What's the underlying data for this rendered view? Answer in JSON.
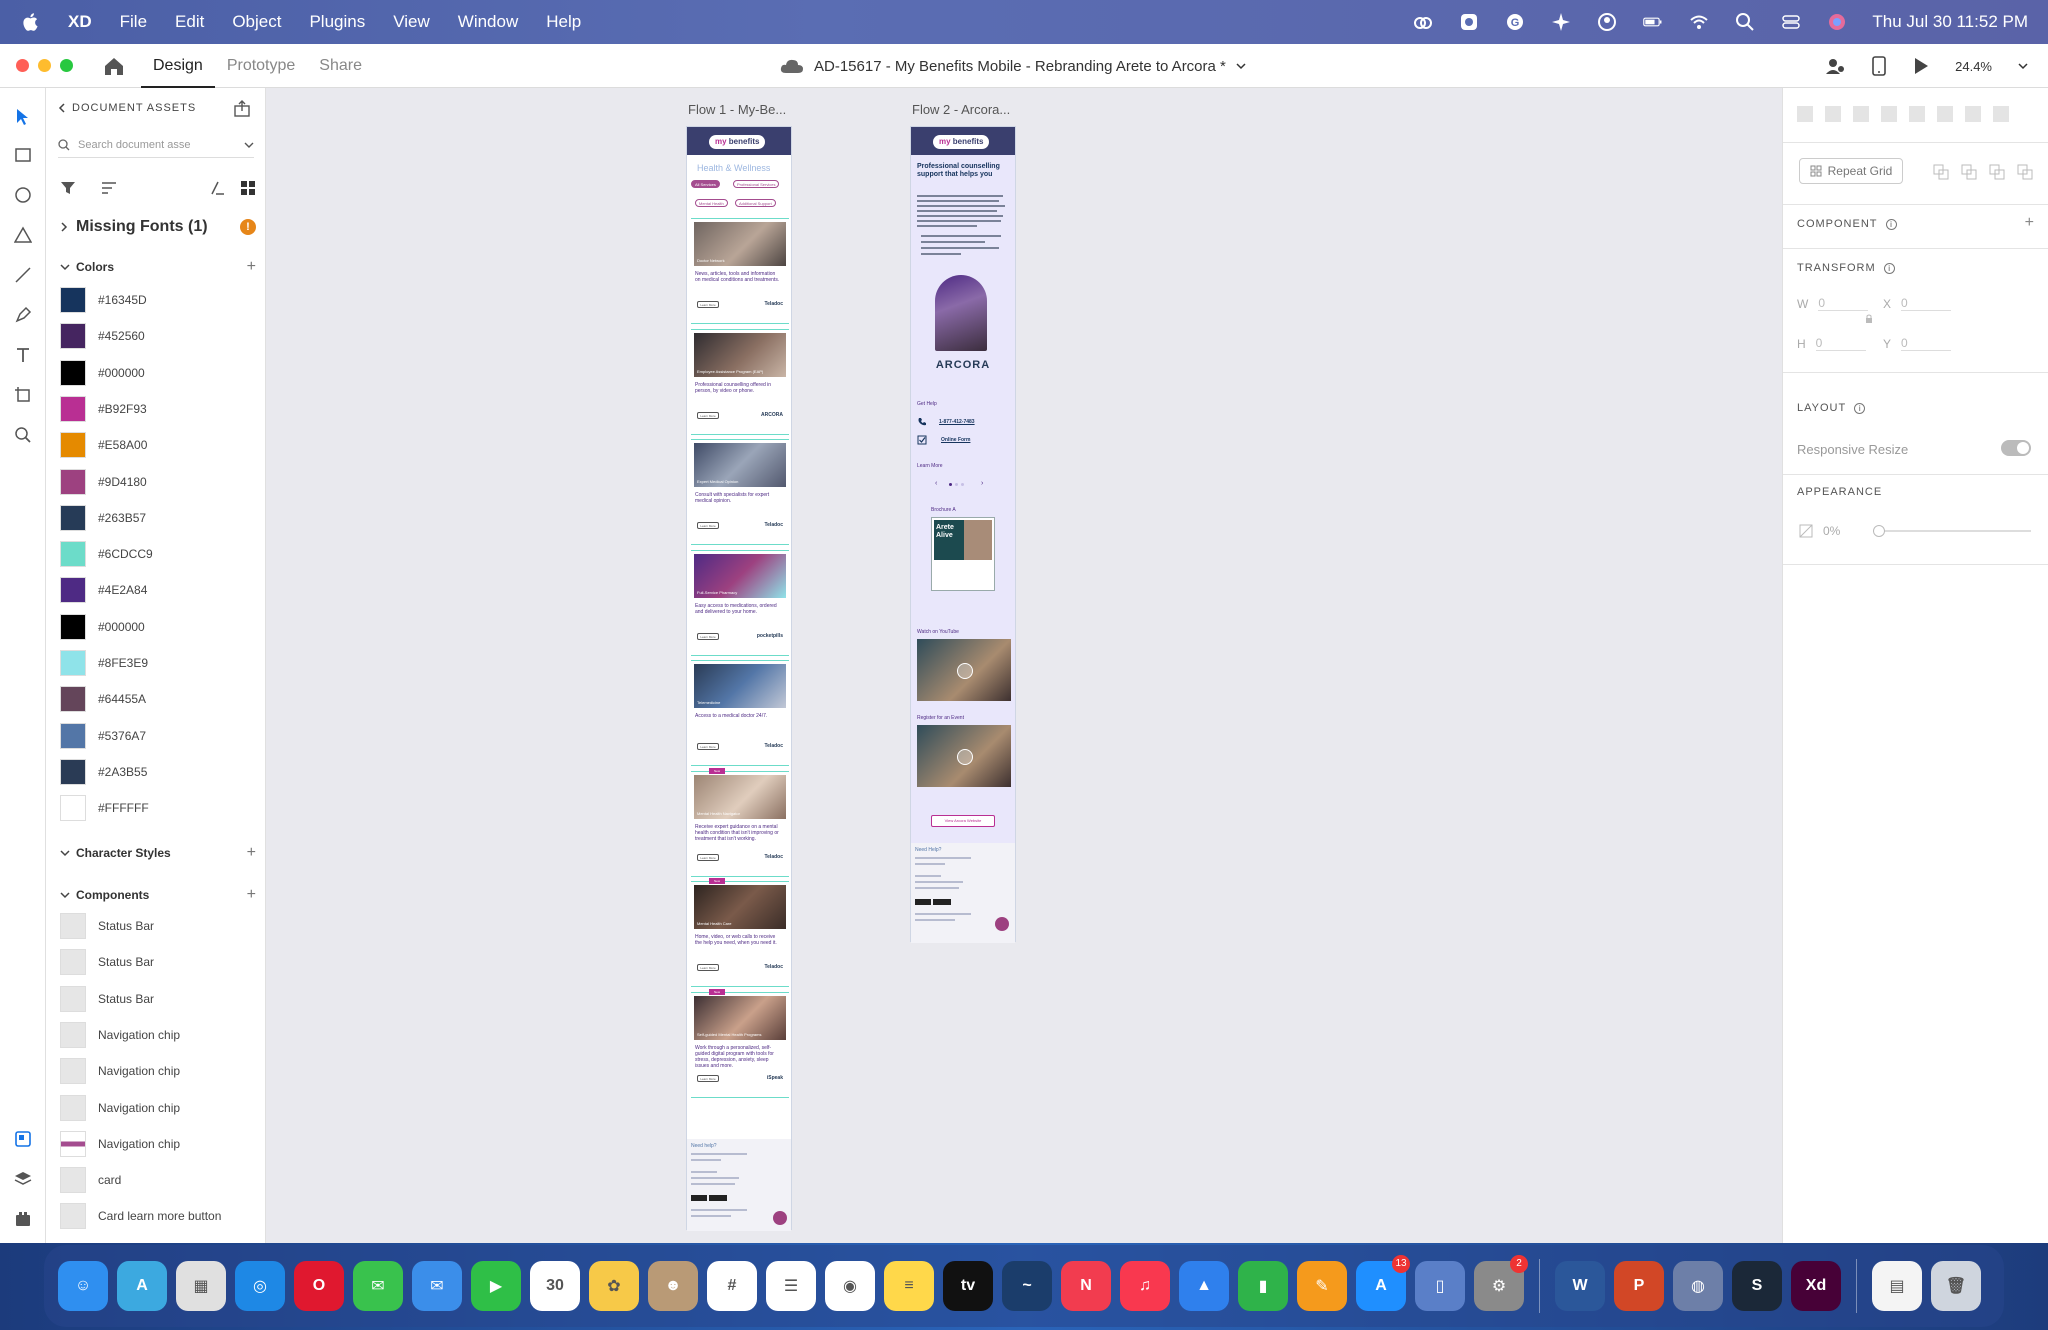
{
  "menubar": {
    "app_name": "XD",
    "menus": [
      "File",
      "Edit",
      "Object",
      "Plugins",
      "View",
      "Window",
      "Help"
    ],
    "datetime": "Thu Jul 30  11:52 PM"
  },
  "toolbar": {
    "tabs": [
      "Design",
      "Prototype",
      "Share"
    ],
    "document_title": "AD-15617 - My Benefits Mobile - Rebranding Arete to Arcora *",
    "zoom": "24.4%"
  },
  "assets": {
    "header": "DOCUMENT ASSETS",
    "search_placeholder": "Search document asse",
    "missing_fonts": "Missing Fonts (1)",
    "missing_count": "!",
    "colors_label": "Colors",
    "colors": [
      {
        "hex": "#16345D",
        "label": "#16345D"
      },
      {
        "hex": "#452560",
        "label": "#452560"
      },
      {
        "hex": "#000000",
        "label": "#000000"
      },
      {
        "hex": "#B92F93",
        "label": "#B92F93"
      },
      {
        "hex": "#E58A00",
        "label": "#E58A00"
      },
      {
        "hex": "#9D4180",
        "label": "#9D4180"
      },
      {
        "hex": "#263B57",
        "label": "#263B57"
      },
      {
        "hex": "#6CDCC9",
        "label": "#6CDCC9"
      },
      {
        "hex": "#4E2A84",
        "label": "#4E2A84"
      },
      {
        "hex": "#000000",
        "label": "#000000"
      },
      {
        "hex": "#8FE3E9",
        "label": "#8FE3E9"
      },
      {
        "hex": "#64455A",
        "label": "#64455A"
      },
      {
        "hex": "#5376A7",
        "label": "#5376A7"
      },
      {
        "hex": "#2A3B55",
        "label": "#2A3B55"
      },
      {
        "hex": "#FFFFFF",
        "label": "#FFFFFF"
      }
    ],
    "char_styles_label": "Character Styles",
    "components_label": "Components",
    "components": [
      "Status Bar",
      "Status Bar",
      "Status Bar",
      "Navigation chip",
      "Navigation chip",
      "Navigation chip",
      "Navigation chip",
      "card",
      "Card learn more button"
    ]
  },
  "canvas": {
    "flow1_label": "Flow 1 - My-Be...",
    "flow2_label": "Flow 2 - Arcora...",
    "flow1": {
      "logo_prefix": "my",
      "logo_word": "benefits",
      "section_title": "Health & Wellness",
      "chips": [
        "All Services",
        "Professional Services",
        "Mental Health",
        "Additional Support"
      ],
      "cards": [
        {
          "caption": "Doctor Network",
          "text": "News, articles, tools and information on medical conditions and treatments.",
          "logo": "Teladoc",
          "btn": "Learn More",
          "new": false
        },
        {
          "caption": "Employee Assistance Program (EAP)",
          "text": "Professional counselling offered in person, by video or phone.",
          "logo": "ARCORA",
          "btn": "Learn More",
          "new": false
        },
        {
          "caption": "Expert Medical Opinion",
          "text": "Consult with specialists for expert medical opinion.",
          "logo": "Teladoc",
          "btn": "Learn More",
          "new": false
        },
        {
          "caption": "Full-Service Pharmacy",
          "text": "Easy access to medications, ordered and delivered to your home.",
          "logo": "pocketpills",
          "btn": "Learn More",
          "new": false
        },
        {
          "caption": "Telemedicine",
          "text": "Access to a medical doctor 24/7.",
          "logo": "Teladoc",
          "btn": "Learn More",
          "new": false
        },
        {
          "caption": "Mental Health Navigator",
          "text": "Receive expert guidance on a mental health condition that isn't improving or treatment that isn't working.",
          "logo": "Teladoc",
          "btn": "Learn More",
          "new": true
        },
        {
          "caption": "Mental Health Care",
          "text": "Home, video, or web calls to receive the help you need, when you need it.",
          "logo": "Teladoc",
          "btn": "Learn More",
          "new": true
        },
        {
          "caption": "Self-guided Mental Health Programs",
          "text": "Work through a personalized, self-guided digital program with tools for stress, depression, anxiety, sleep issues and more.",
          "logo": "iSpeak",
          "btn": "Learn More",
          "new": true
        }
      ],
      "badge_new": "New",
      "footer_title": "Need help?"
    },
    "flow2": {
      "title": "Professional counselling support that helps you",
      "brand": "ARCORA",
      "get_help": "Get Help",
      "phone": "1-877-412-7483",
      "online_form": "Online Form",
      "learn_more": "Learn More",
      "brochure": "Brochure A",
      "brochure_title": "Arete Alive",
      "video1": "Watch on YouTube",
      "video2": "Register for an Event",
      "cta": "View Arcora Website",
      "footer_title": "Need Help?"
    }
  },
  "props": {
    "repeat_grid": "Repeat Grid",
    "component": "COMPONENT",
    "transform": "TRANSFORM",
    "w_label": "W",
    "w_value": "0",
    "h_label": "H",
    "h_value": "0",
    "x_label": "X",
    "x_value": "0",
    "y_label": "Y",
    "y_value": "0",
    "layout": "LAYOUT",
    "responsive_resize": "Responsive Resize",
    "appearance": "APPEARANCE",
    "opacity": "0%"
  },
  "dock": {
    "apps": [
      {
        "name": "Finder",
        "color": "#2f8ff0",
        "glyph": "☺"
      },
      {
        "name": "Maps",
        "color": "#3ca9e0",
        "glyph": "A"
      },
      {
        "name": "Launchpad",
        "color": "#e0e0e0",
        "glyph": "▦"
      },
      {
        "name": "Safari",
        "color": "#1e88e5",
        "glyph": "◎"
      },
      {
        "name": "Opera",
        "color": "#e0182f",
        "glyph": "O"
      },
      {
        "name": "Messages",
        "color": "#39c24d",
        "glyph": "✉"
      },
      {
        "name": "Mail",
        "color": "#3b8eea",
        "glyph": "✉"
      },
      {
        "name": "FaceTime",
        "color": "#2fbf47",
        "glyph": "▶"
      },
      {
        "name": "Calendar",
        "color": "#ffffff",
        "glyph": "30"
      },
      {
        "name": "Photos",
        "color": "#f7c948",
        "glyph": "✿"
      },
      {
        "name": "Contacts",
        "color": "#b99a76",
        "glyph": "☻"
      },
      {
        "name": "Slack",
        "color": "#ffffff",
        "glyph": "#"
      },
      {
        "name": "Reminders",
        "color": "#ffffff",
        "glyph": "☰"
      },
      {
        "name": "Chrome",
        "color": "#ffffff",
        "glyph": "◉"
      },
      {
        "name": "Notes",
        "color": "#ffd84a",
        "glyph": "≡"
      },
      {
        "name": "Apple TV",
        "color": "#111111",
        "glyph": "tv"
      },
      {
        "name": "Freeform",
        "color": "#1b3d6b",
        "glyph": "~"
      },
      {
        "name": "News",
        "color": "#f23c4f",
        "glyph": "N"
      },
      {
        "name": "Music",
        "color": "#f9384f",
        "glyph": "♫"
      },
      {
        "name": "Keynote",
        "color": "#2f80ed",
        "glyph": "▲"
      },
      {
        "name": "Numbers",
        "color": "#2fb34a",
        "glyph": "▮"
      },
      {
        "name": "Pages",
        "color": "#f59a1c",
        "glyph": "✎"
      },
      {
        "name": "App Store",
        "color": "#1f8fff",
        "glyph": "A",
        "badge": "13"
      },
      {
        "name": "Simulator",
        "color": "#5a7fc8",
        "glyph": "▯"
      },
      {
        "name": "System Settings",
        "color": "#8a8a8a",
        "glyph": "⚙",
        "badge": "2"
      },
      {
        "name": "Word",
        "color": "#2b579a",
        "glyph": "W"
      },
      {
        "name": "PowerPoint",
        "color": "#d24726",
        "glyph": "P"
      },
      {
        "name": "Automator",
        "color": "#6d7fa8",
        "glyph": "◍"
      },
      {
        "name": "Steam",
        "color": "#1b2838",
        "glyph": "S"
      },
      {
        "name": "Adobe XD",
        "color": "#470137",
        "glyph": "Xd"
      },
      {
        "name": "Documents",
        "color": "#f4f4f4",
        "glyph": "▤"
      },
      {
        "name": "Trash",
        "color": "#cfd5de",
        "glyph": "🗑"
      }
    ]
  }
}
